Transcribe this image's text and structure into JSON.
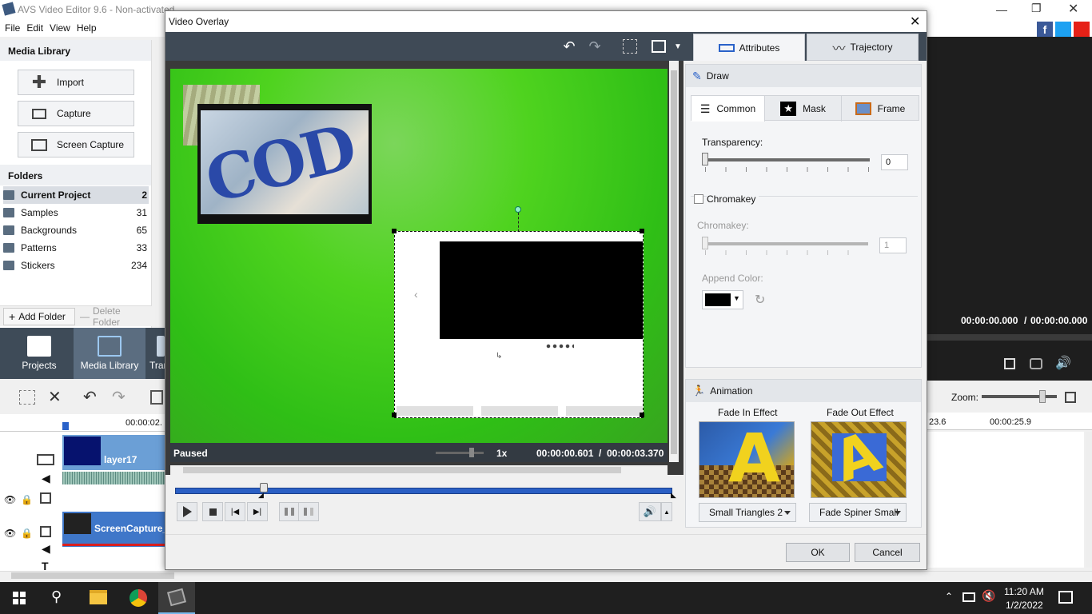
{
  "app": {
    "title": "AVS Video Editor 9.6 - Non-activated",
    "menu": [
      "File",
      "Edit",
      "View",
      "Help"
    ]
  },
  "sidebar": {
    "media_library_title": "Media Library",
    "buttons": [
      "Import",
      "Capture",
      "Screen Capture"
    ],
    "folders_title": "Folders",
    "folders": [
      {
        "name": "Current Project",
        "count": "2"
      },
      {
        "name": "Samples",
        "count": "31"
      },
      {
        "name": "Backgrounds",
        "count": "65"
      },
      {
        "name": "Patterns",
        "count": "33"
      },
      {
        "name": "Stickers",
        "count": "234"
      }
    ],
    "add_folder": "Add Folder",
    "delete_folder": "Delete Folder"
  },
  "modes": {
    "projects": "Projects",
    "media_library": "Media Library",
    "transitions": "Tran"
  },
  "timeline": {
    "ruler_time": "00:00:02.",
    "track1_label": "layer17",
    "track2_label": "ScreenCapture_",
    "right_time_a": "23.6",
    "right_time_b": "00:00:25.9",
    "zoom_label": "Zoom:"
  },
  "right_preview": {
    "time_current": "00:00:00.000",
    "time_sep": "/",
    "time_total": "00:00:00.000"
  },
  "dialog": {
    "title": "Video Overlay",
    "tabs": {
      "attributes": "Attributes",
      "trajectory": "Trajectory"
    },
    "status": {
      "state": "Paused",
      "speed": "1x",
      "current": "00:00:00.601",
      "sep": "/",
      "total": "00:00:03.370"
    },
    "draw": {
      "title": "Draw",
      "subtabs": [
        "Common",
        "Mask",
        "Frame"
      ],
      "transparency_label": "Transparency:",
      "transparency_value": "0",
      "chromakey_checkbox": "Chromakey",
      "chromakey_label": "Chromakey:",
      "chromakey_value": "1",
      "append_color_label": "Append Color:"
    },
    "animation": {
      "title": "Animation",
      "fade_in_label": "Fade In Effect",
      "fade_out_label": "Fade Out Effect",
      "fade_in_value": "Small Triangles 2",
      "fade_out_value": "Fade Spiner Small"
    },
    "ok": "OK",
    "cancel": "Cancel"
  },
  "taskbar": {
    "time": "11:20 AM",
    "date": "1/2/2022"
  }
}
